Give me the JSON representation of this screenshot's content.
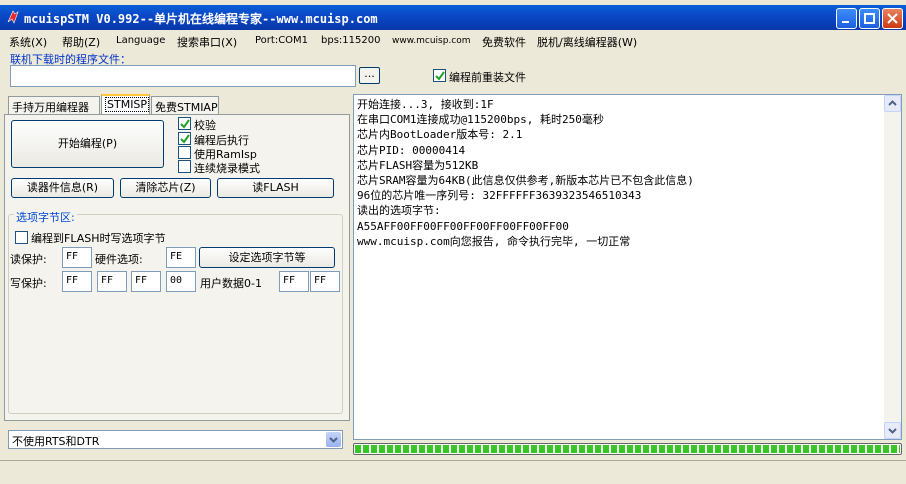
{
  "title": "mcuispSTM V0.992--单片机在线编程专家--www.mcuisp.com",
  "menu": [
    "系统(X)",
    "帮助(Z)",
    "Language",
    "搜索串口(X)",
    "Port:COM1",
    "bps:115200",
    "www.mcuisp.com",
    "免费软件",
    "脱机/离线编程器(W)"
  ],
  "file_section": {
    "label": "联机下载时的程序文件：",
    "value": "",
    "browse": "...",
    "reload_label": "编程前重装文件",
    "reload_checked": true
  },
  "tabs": [
    "手持万用编程器",
    "STMISP",
    "免费STMIAP"
  ],
  "active_tab": 1,
  "program": {
    "start_button": "开始编程(P)",
    "options": [
      {
        "label": "校验",
        "checked": true
      },
      {
        "label": "编程后执行",
        "checked": true
      },
      {
        "label": "使用RamIsp",
        "checked": false
      },
      {
        "label": "连续烧录模式",
        "checked": false
      }
    ],
    "read_info_button": "读器件信息(R)",
    "erase_button": "清除芯片(Z)",
    "read_flash_button": "读FLASH"
  },
  "option_bytes": {
    "title": "选项字节区:",
    "write_flag_label": "编程到FLASH时写选项字节",
    "write_flag_checked": false,
    "read_protect_label": "读保护:",
    "read_protect": "FF",
    "hw_option_label": "硬件选项:",
    "hw_option": "FE",
    "set_button": "设定选项字节等",
    "write_protect_label": "写保护:",
    "write_protect": [
      "FF",
      "FF",
      "FF",
      "00"
    ],
    "user_data_label": "用户数据0-1",
    "user_data": [
      "FF",
      "FF"
    ]
  },
  "rts_dtr": "不使用RTS和DTR",
  "log": [
    "开始连接...3, 接收到:1F",
    "在串口COM1连接成功@115200bps, 耗时250毫秒",
    "芯片内BootLoader版本号: 2.1",
    "芯片PID: 00000414",
    "芯片FLASH容量为512KB",
    "芯片SRAM容量为64KB(此信息仅供参考,新版本芯片已不包含此信息)",
    "96位的芯片唯一序列号: 32FFFFFF3639323546510343",
    "读出的选项字节:",
    "A55AFF00FF00FF00FF00FF00FF00FF00",
    "www.mcuisp.com向您报告, 命令执行完毕, 一切正常"
  ],
  "progress_percent": 100,
  "colors": {
    "titlebar": "#0a49c7",
    "progress": "#37c623",
    "group_title": "#0046d5"
  }
}
